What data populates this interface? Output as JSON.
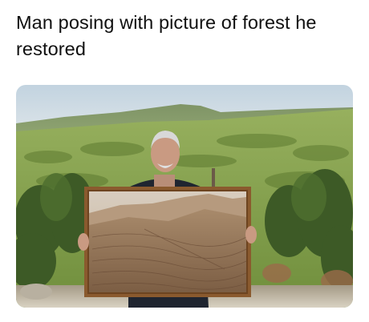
{
  "post": {
    "caption": "Man posing with picture of forest he restored"
  },
  "photo": {
    "icon": "photo-image",
    "colors": {
      "sky": "#c9d6e0",
      "forest_light": "#8fa85a",
      "forest_dark": "#3f5a2a",
      "frame": "#8a5a2e",
      "sepia": "#9c7a5c"
    }
  }
}
